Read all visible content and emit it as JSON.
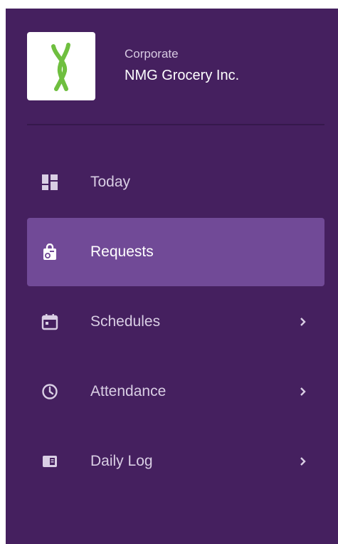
{
  "org": {
    "type": "Corporate",
    "name": "NMG Grocery Inc."
  },
  "nav": {
    "items": [
      {
        "label": "Today",
        "icon": "dashboard-icon",
        "active": false,
        "has_submenu": false
      },
      {
        "label": "Requests",
        "icon": "request-bag-icon",
        "active": true,
        "has_submenu": false
      },
      {
        "label": "Schedules",
        "icon": "calendar-icon",
        "active": false,
        "has_submenu": true
      },
      {
        "label": "Attendance",
        "icon": "clock-icon",
        "active": false,
        "has_submenu": true
      },
      {
        "label": "Daily Log",
        "icon": "log-book-icon",
        "active": false,
        "has_submenu": true
      }
    ]
  },
  "colors": {
    "sidebar_bg": "#45205f",
    "active_bg": "#714a97",
    "divider": "#36184c",
    "logo_green": "#6fbf3f",
    "text": "#d9cee4",
    "text_active": "#ffffff"
  }
}
